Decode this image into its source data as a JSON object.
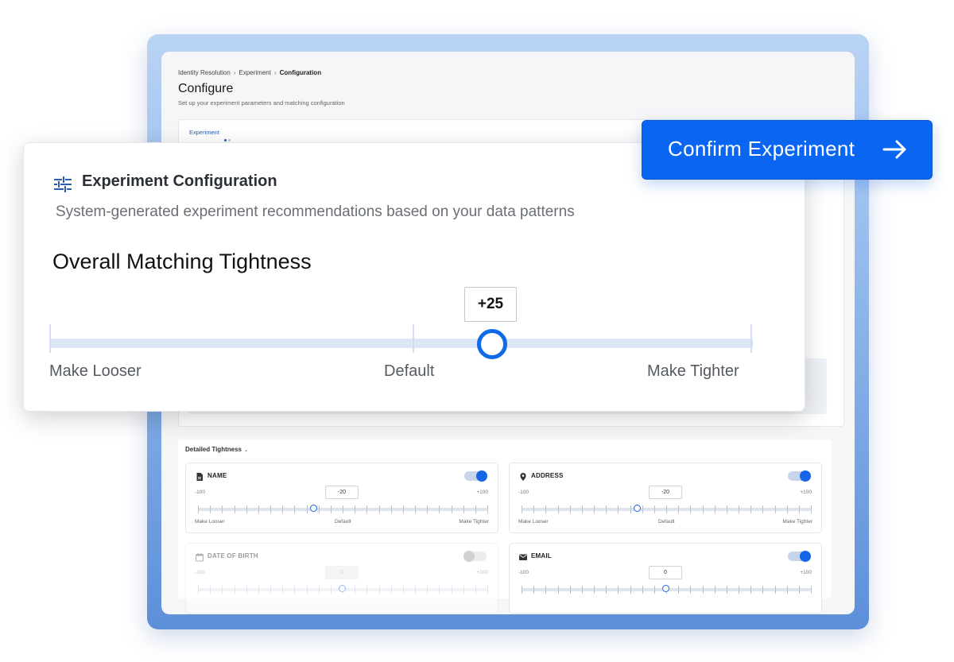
{
  "breadcrumb": {
    "items": [
      "Identity Resolution",
      "Experiment",
      "Configuration"
    ]
  },
  "page": {
    "title": "Configure",
    "subtitle": "Set up your experiment parameters and matching configuration",
    "tab_label": "Experiment"
  },
  "overlay": {
    "title": "Experiment Configuration",
    "subtitle": "System-generated experiment recommendations based on your data patterns",
    "icon": "sliders-icon",
    "slider": {
      "heading": "Overall Matching Tightness",
      "value_label": "+25",
      "value": 25,
      "min": -100,
      "max": 100,
      "left_label": "Make Looser",
      "mid_label": "Default",
      "right_label": "Make Tighter"
    }
  },
  "confirm_button": {
    "label": "Confirm Experiment",
    "icon": "arrow-right-icon",
    "color": "#0a66f0"
  },
  "detailed": {
    "title": "Detailed Tightness",
    "fields": [
      {
        "label": "NAME",
        "icon": "document-icon",
        "enabled": true,
        "value_label": "-20",
        "value": -20,
        "min_label": "-100",
        "max_label": "+100",
        "left": "Make Looser",
        "mid": "Default",
        "right": "Make Tighter"
      },
      {
        "label": "ADDRESS",
        "icon": "location-pin-icon",
        "enabled": true,
        "value_label": "-20",
        "value": -20,
        "min_label": "-100",
        "max_label": "+100",
        "left": "Make Looser",
        "mid": "Default",
        "right": "Make Tighter"
      },
      {
        "label": "DATE OF BIRTH",
        "icon": "calendar-icon",
        "enabled": false,
        "value_label": "0",
        "value": 0,
        "min_label": "-100",
        "max_label": "+100"
      },
      {
        "label": "EMAIL",
        "icon": "envelope-icon",
        "enabled": true,
        "value_label": "0",
        "value": 0,
        "min_label": "-100",
        "max_label": "+100"
      }
    ]
  },
  "colors": {
    "accent": "#0f6ae8",
    "track": "#dce8f8",
    "frame": "#8fb6ea"
  }
}
